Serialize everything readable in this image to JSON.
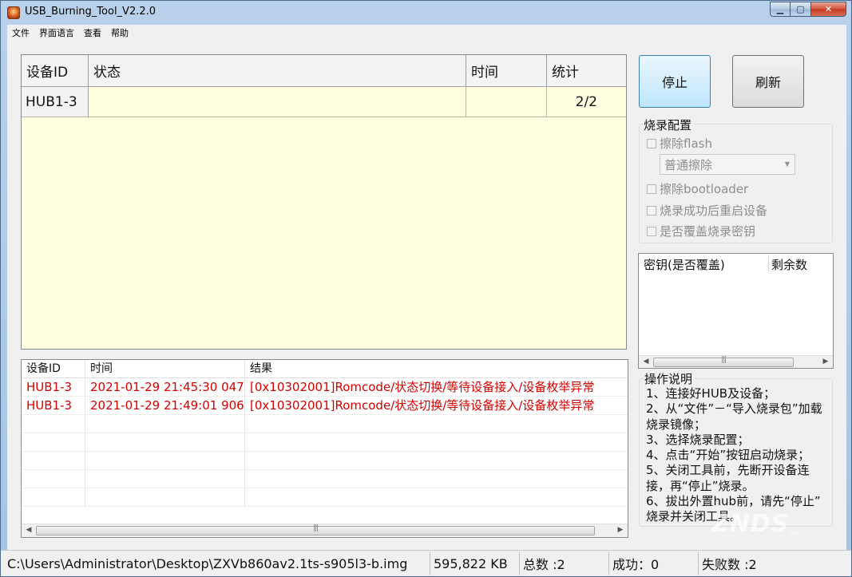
{
  "window": {
    "title": "USB_Burning_Tool_V2.2.0",
    "controls": {
      "minimize": "▁",
      "maximize": "▢",
      "close": "✕"
    }
  },
  "menu": [
    "文件",
    "界面语言",
    "查看",
    "帮助"
  ],
  "device_grid": {
    "headers": [
      "设备ID",
      "状态",
      "时间",
      "统计"
    ],
    "rows": [
      {
        "id": "HUB1-3",
        "status": "",
        "time": "",
        "count": "2/2"
      }
    ]
  },
  "log": {
    "headers": [
      "设备ID",
      "时间",
      "结果"
    ],
    "rows": [
      {
        "id": "HUB1-3",
        "time": "2021-01-29 21:45:30 047",
        "result": "[0x10302001]Romcode/状态切换/等待设备接入/设备枚举异常"
      },
      {
        "id": "HUB1-3",
        "time": "2021-01-29 21:49:01 906",
        "result": "[0x10302001]Romcode/状态切换/等待设备接入/设备枚举异常"
      }
    ]
  },
  "buttons": {
    "stop": "停止",
    "refresh": "刷新"
  },
  "burn_config": {
    "label": "烧录配置",
    "erase_flash": "擦除flash",
    "erase_mode": "普通擦除",
    "erase_bootloader": "擦除bootloader",
    "reboot_after": "烧录成功后重启设备",
    "overwrite_key": "是否覆盖烧录密钥"
  },
  "key_list": {
    "headers": [
      "密钥(是否覆盖)",
      "剩余数"
    ]
  },
  "instructions": {
    "label": "操作说明",
    "lines": [
      "1、连接好HUB及设备；",
      "2、从“文件”－“导入烧录包”加载",
      "烧录镜像；",
      "3、选择烧录配置；",
      "4、点击“开始”按钮启动烧录；",
      "5、关闭工具前，先断开设备连",
      "接，再“停止”烧录。",
      "6、拔出外置hub前，请先“停止”",
      "烧录并关闭工具。"
    ]
  },
  "status_bar": {
    "path": "C:\\Users\\Administrator\\Desktop\\ZXVb860av2.1ts-s905l3-b.img",
    "size": "595,822 KB",
    "total": "总数 :2",
    "success": "成功：0",
    "fail": "失败数 :2"
  },
  "watermark": {
    "brand": "ZNDS",
    "domain": ".com"
  }
}
